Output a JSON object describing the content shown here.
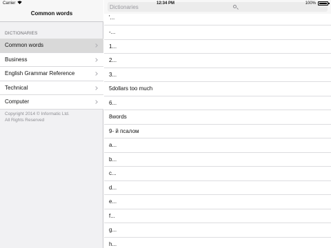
{
  "status_bar": {
    "carrier": "Carrier",
    "time": "12:34 PM",
    "battery": "100%"
  },
  "master": {
    "title": "Common words",
    "section_header": "DICTIONARIES",
    "items": [
      {
        "label": "Common words",
        "selected": true
      },
      {
        "label": "Business",
        "selected": false
      },
      {
        "label": "English Grammar Reference",
        "selected": false
      },
      {
        "label": "Technical",
        "selected": false
      },
      {
        "label": "Computer",
        "selected": false
      }
    ],
    "copyright_line1": "Copyright 2014 © Informatic Ltd.",
    "copyright_line2": "All Rights Reserved"
  },
  "detail": {
    "search_placeholder": "Dictionaries",
    "top_partial_word": "'...",
    "words": [
      "-...",
      "1...",
      "2...",
      "3...",
      "5dollars too much",
      "6...",
      "8words",
      "9- й псалом",
      "a...",
      "b...",
      "c...",
      "d...",
      "e...",
      "f...",
      "g...",
      "h..."
    ]
  },
  "colors": {
    "sidebar_bg": "#f1f1f3",
    "selected_row": "#d9d9d9",
    "separator": "#dcdcdf"
  }
}
